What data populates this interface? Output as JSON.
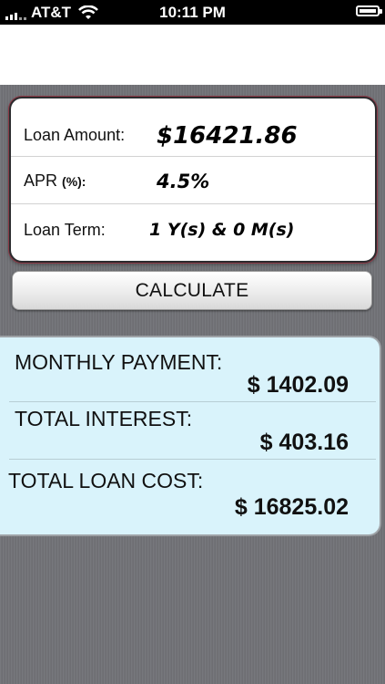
{
  "status_bar": {
    "carrier": "AT&T",
    "time": "10:11 PM"
  },
  "inputs": {
    "loan_amount_label": "Loan Amount:",
    "loan_amount_value": "$16421.86",
    "apr_label": "APR",
    "apr_unit": "(%):",
    "apr_value": "4.5%",
    "loan_term_label": "Loan Term:",
    "loan_term_value": "1 Y(s) & 0 M(s)"
  },
  "calculate_label": "CALCULATE",
  "results": {
    "monthly_payment_label": "MONTHLY PAYMENT:",
    "monthly_payment_value": "$ 1402.09",
    "total_interest_label": "TOTAL INTEREST:",
    "total_interest_value": "$ 403.16",
    "total_loan_cost_label": "TOTAL LOAN COST:",
    "total_loan_cost_value": "$ 16825.02"
  },
  "colors": {
    "results_bg": "#d9f3fb",
    "background": "#707176"
  }
}
